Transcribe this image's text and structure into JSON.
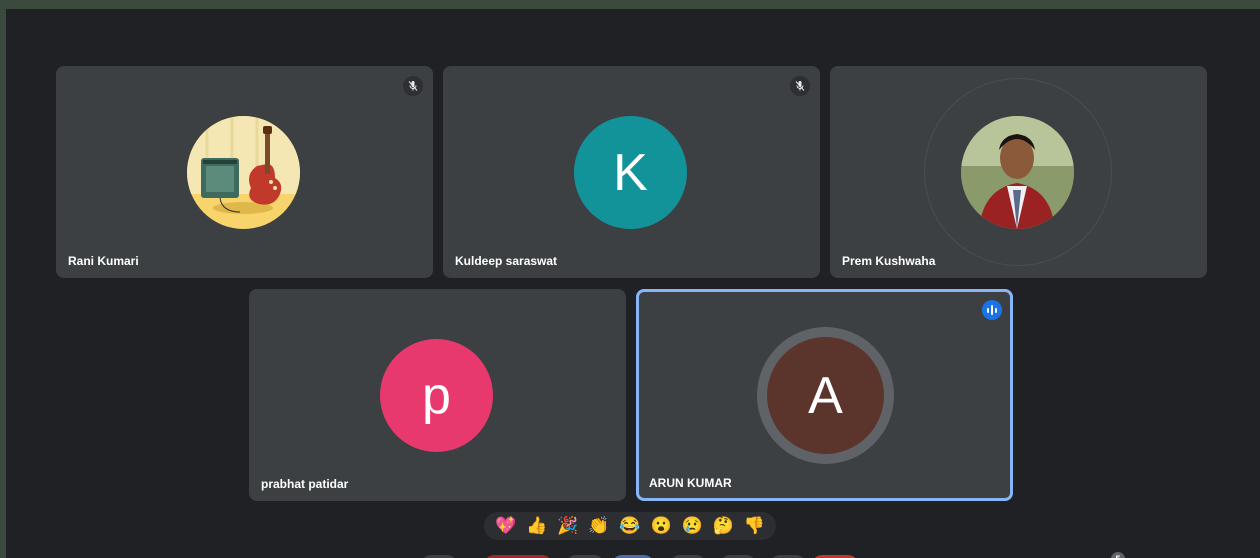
{
  "participants": [
    {
      "name": "Rani Kumari",
      "muted": true,
      "avatar_type": "guitar-illustration"
    },
    {
      "name": "Kuldeep saraswat",
      "muted": true,
      "initial": "K",
      "avatar_color": "#12939a"
    },
    {
      "name": "Prem Kushwaha",
      "muted": false,
      "avatar_type": "photo"
    },
    {
      "name": "prabhat patidar",
      "muted": false,
      "initial": "p",
      "avatar_color": "#e8396f"
    },
    {
      "name": "ARUN KUMAR",
      "muted": false,
      "speaking": true,
      "initial": "A",
      "avatar_color": "#5b352c"
    }
  ],
  "reactions": [
    "💖",
    "👍",
    "🎉",
    "👏",
    "😂",
    "😮",
    "😢",
    "🤔",
    "👎"
  ],
  "people_count": "5",
  "colors": {
    "background": "#202124",
    "tile": "#3c4043",
    "active_border": "#8ab4f8",
    "speaking_indicator": "#1a73e8"
  }
}
